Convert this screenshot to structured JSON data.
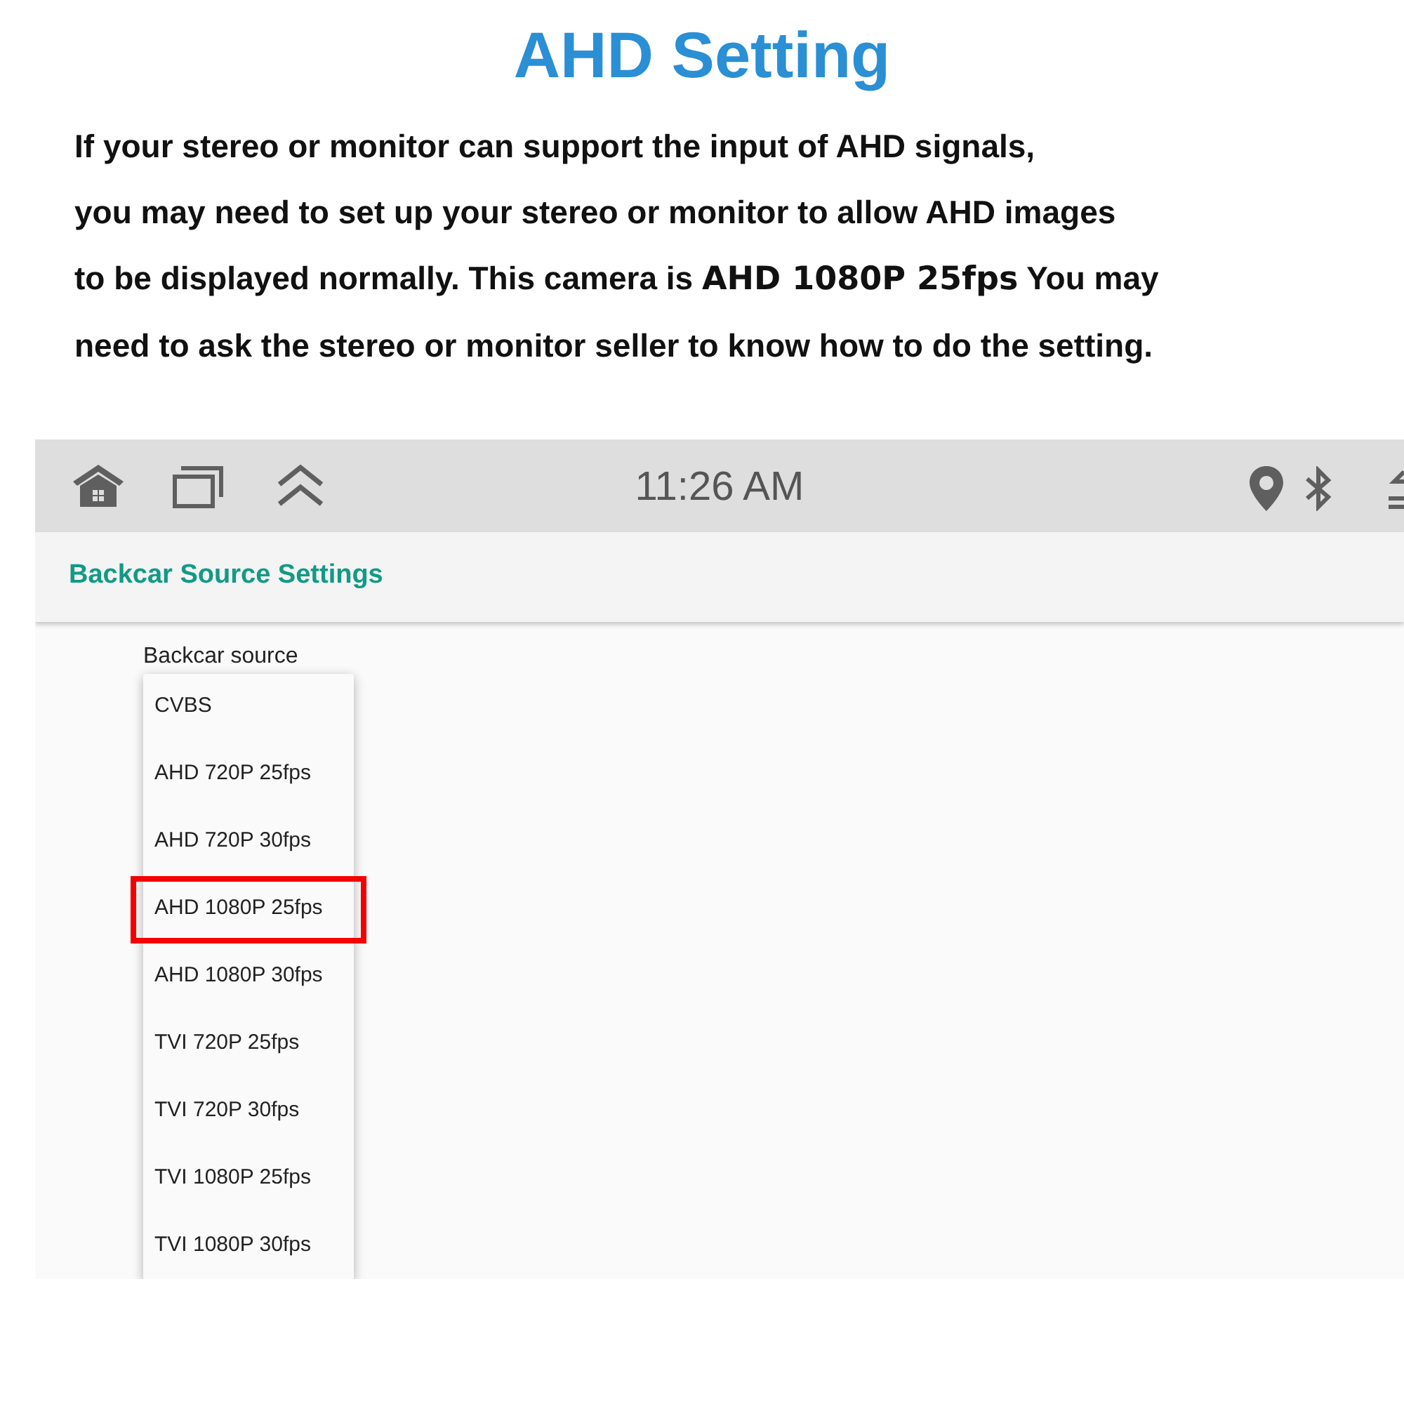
{
  "heading": "AHD Setting",
  "paragraph": "If your stereo or monitor can support the input of AHD signals,\nyou may need to set up your stereo or monitor to allow AHD images\nto be displayed normally. This camera is **AHD 1080P 25fps** You may\nneed to ask the stereo or monitor seller to know how to do the setting.",
  "screen": {
    "status_bar": {
      "time": "11:26 AM"
    },
    "title": "Backcar Source Settings",
    "field_label": "Backcar source",
    "options": [
      {
        "label": "CVBS",
        "highlighted": false
      },
      {
        "label": "AHD 720P 25fps",
        "highlighted": false
      },
      {
        "label": "AHD 720P 30fps",
        "highlighted": false
      },
      {
        "label": "AHD 1080P 25fps",
        "highlighted": true
      },
      {
        "label": "AHD 1080P 30fps",
        "highlighted": false
      },
      {
        "label": "TVI 720P 25fps",
        "highlighted": false
      },
      {
        "label": "TVI 720P 30fps",
        "highlighted": false
      },
      {
        "label": "TVI 1080P 25fps",
        "highlighted": false
      },
      {
        "label": "TVI 1080P 30fps",
        "highlighted": false
      }
    ]
  }
}
